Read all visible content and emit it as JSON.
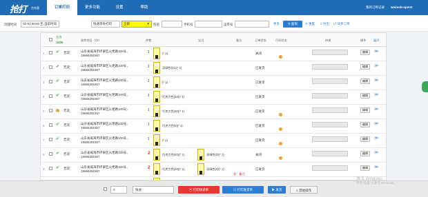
{
  "header": {
    "logo": "抢打",
    "logo_sub": "京东版",
    "tabs": [
      "订单打印",
      "更多功能",
      "设置",
      "帮助"
    ],
    "active_tab": "订单打印",
    "login_link": "我的订购记录",
    "user": "weimob-open2"
  },
  "filter": {
    "time_label": "创建时间",
    "time_value": "02-01 00:00",
    "time_to": "至 当前时间",
    "delivery_select": "快递单未打印",
    "status_select": "全部",
    "account_label": "旺名",
    "phone_label": "手机号",
    "order_no_label": "运单号",
    "more_link": "更多",
    "search_button": "查询",
    "reset_link": "重置",
    "export_link": "导出",
    "sync_link": "同步订单"
  },
  "table": {
    "select_all": "全选",
    "page_count": "19/20",
    "headers": [
      "收件地区（24）",
      "件数",
      "宝贝",
      "备注",
      "订单状态",
      "打印状态",
      "快递",
      "操作",
      "展开"
    ],
    "rows": [
      {
        "num": "1",
        "status_icon": "check",
        "status": "无双",
        "address": [
          "山东省威海市环翠区火炬路100号，",
          "15666291557"
        ],
        "qty": "1",
        "qty_red": false,
        "products": [
          "(* 1)"
        ],
        "remark": "",
        "order_status": "关闭",
        "printed": true,
        "edit": "编辑"
      },
      {
        "num": "2",
        "status_icon": "check",
        "status": "无双",
        "address": [
          "山东省威海市环翠区火炬路100号，",
          "15666291557"
        ],
        "qty": "1",
        "qty_red": false,
        "products": [
          "深绿色(XL)(* 1)"
        ],
        "remark": "",
        "order_status": "已发货",
        "printed": false,
        "edit": "编辑"
      },
      {
        "num": "3",
        "status_icon": "check",
        "status": "无双",
        "address": [
          "山东省威海市环翠区火炬路100号，",
          "15666291557"
        ],
        "qty": "1",
        "qty_red": false,
        "products": [
          "(* 1)"
        ],
        "remark": "",
        "order_status": "已发货",
        "printed": false,
        "edit": "编辑"
      },
      {
        "num": "4",
        "status_icon": "check",
        "status": "无双",
        "address": [
          "山东省威海市环翠区火炬路100号，",
          "15666291557"
        ],
        "qty": "1",
        "qty_red": false,
        "products": [
          "巧克力色(40)(* 1)"
        ],
        "remark": "",
        "order_status": "已发货",
        "printed": false,
        "edit": "编辑"
      },
      {
        "num": "5",
        "status_icon": "dot",
        "status": "无双",
        "address": [
          "山东省威海市环翠区火炬路100号，",
          "15666291557"
        ],
        "qty": "1",
        "qty_red": false,
        "products": [
          "巧克力色(40)(* 1)"
        ],
        "remark": "",
        "order_status": "已发货",
        "printed": true,
        "edit": "编辑"
      },
      {
        "num": "6",
        "status_icon": "check",
        "status": "无双",
        "address": [
          "山东省威海市环翠区火炬路100号，",
          "15666291557"
        ],
        "qty": "1",
        "qty_red": false,
        "products": [
          "巧克力色(0)(* 1)"
        ],
        "remark": "",
        "order_status": "已发货",
        "printed": true,
        "edit": "编辑"
      },
      {
        "num": "7",
        "status_icon": "check",
        "status": "无双",
        "address": [
          "山东省威海市环翠区火炬路100号，",
          "15666291557"
        ],
        "qty": "1",
        "qty_red": false,
        "products": [
          "(* 1)"
        ],
        "remark": "",
        "order_status": "已发货",
        "printed": true,
        "edit": "编辑"
      },
      {
        "num": "8",
        "status_icon": "check",
        "status": "无双",
        "address": [
          "山东省威海市环翠区火炬路100号，",
          "15666291557"
        ],
        "qty": "2",
        "qty_red": true,
        "products": [
          "巧克力色(40)(* 1)",
          "深绿色(0)(* 1)"
        ],
        "remark": "",
        "order_status": "关闭",
        "printed": true,
        "edit": "编辑"
      },
      {
        "num": "9",
        "status_icon": "check",
        "status": "无双",
        "address": [
          "山东省威海市环翠区火炬路100号，",
          "15666291557"
        ],
        "qty": "2",
        "qty_red": true,
        "products": [
          "巧克力色(40)(* 1)",
          "深绿色(0)(* 1)"
        ],
        "remark": "卖：备注",
        "order_status": "已发货",
        "printed": false,
        "edit": "编辑"
      },
      {
        "num": "10",
        "status_icon": "check",
        "status": "无双",
        "address": [
          "山东省威海市环翠区火炬路100号，",
          "15666291557"
        ],
        "qty": "1",
        "qty_red": false,
        "products": [
          "(* 1)"
        ],
        "remark": "",
        "order_status": "已发货",
        "printed": false,
        "edit": "编辑"
      }
    ]
  },
  "bottom": {
    "count": "0",
    "courier_select": "快递",
    "print_express": "打印快递单",
    "print_invoice": "打印发货单",
    "ship": "发货",
    "other_ops": "其他操作",
    "watermark_line1": "激活 Windows",
    "watermark_line2": "转到\"设置\"以激活 Windows。"
  },
  "colors": {
    "primary": "#1f6bb5",
    "accent": "#2a7fd4",
    "danger": "#e8382e",
    "success": "#3a9a3a",
    "warning": "#f0a030"
  }
}
